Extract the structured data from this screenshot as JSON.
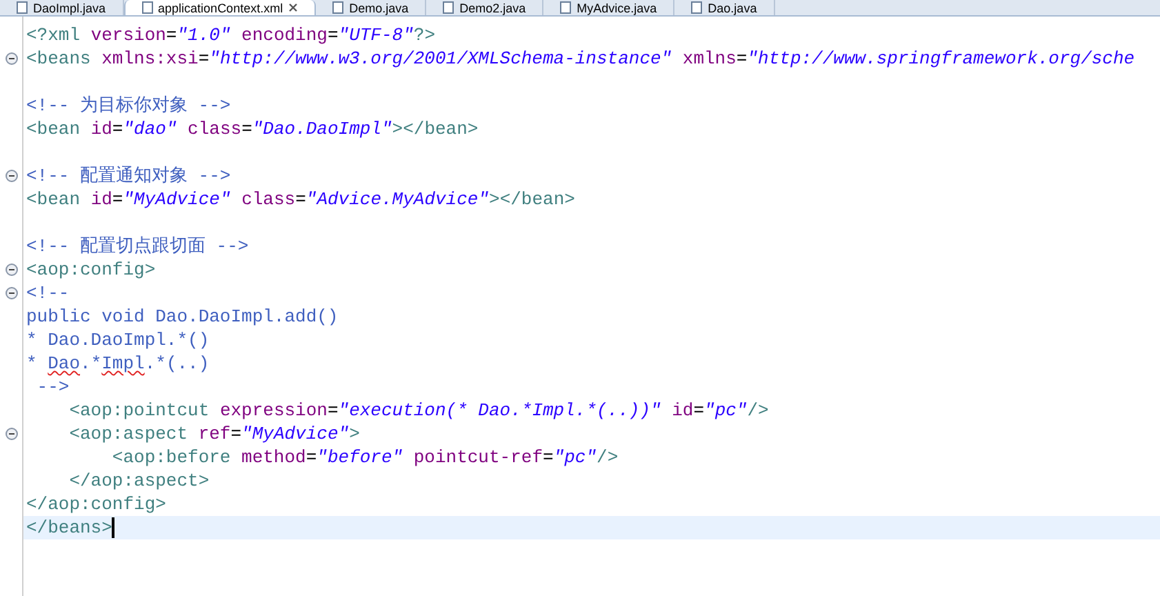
{
  "tabs": [
    {
      "label": "DaoImpl.java",
      "selected": false,
      "closable": false
    },
    {
      "label": "applicationContext.xml",
      "selected": true,
      "closable": true
    },
    {
      "label": "Demo.java",
      "selected": false,
      "closable": false
    },
    {
      "label": "Demo2.java",
      "selected": false,
      "closable": false
    },
    {
      "label": "MyAdvice.java",
      "selected": false,
      "closable": false
    },
    {
      "label": "Dao.java",
      "selected": false,
      "closable": false
    }
  ],
  "editor": {
    "lines": [
      {
        "fold": false,
        "current": false,
        "tokens": [
          {
            "kind": "tag",
            "text": "<?xml "
          },
          {
            "kind": "attr",
            "text": "version"
          },
          {
            "kind": "text",
            "text": "="
          },
          {
            "kind": "value",
            "text": "\"1.0\" "
          },
          {
            "kind": "attr",
            "text": "encoding"
          },
          {
            "kind": "text",
            "text": "="
          },
          {
            "kind": "value",
            "text": "\"UTF-8\""
          },
          {
            "kind": "tag",
            "text": "?>"
          }
        ]
      },
      {
        "fold": true,
        "current": false,
        "tokens": [
          {
            "kind": "tag",
            "text": "<beans "
          },
          {
            "kind": "attr",
            "text": "xmlns:xsi"
          },
          {
            "kind": "text",
            "text": "="
          },
          {
            "kind": "value",
            "text": "\"http://www.w3.org/2001/XMLSchema-instance\" "
          },
          {
            "kind": "attr",
            "text": "xmlns"
          },
          {
            "kind": "text",
            "text": "="
          },
          {
            "kind": "value",
            "text": "\"http://www.springframework.org/sche"
          }
        ]
      },
      {
        "fold": false,
        "current": false
      },
      {
        "fold": false,
        "current": false,
        "tokens": [
          {
            "kind": "comment",
            "text": "<!-- 为目标你对象 -->"
          }
        ]
      },
      {
        "fold": false,
        "current": false,
        "tokens": [
          {
            "kind": "tag",
            "text": "<bean "
          },
          {
            "kind": "attr",
            "text": "id"
          },
          {
            "kind": "text",
            "text": "="
          },
          {
            "kind": "value",
            "text": "\"dao\" "
          },
          {
            "kind": "attr",
            "text": "class"
          },
          {
            "kind": "text",
            "text": "="
          },
          {
            "kind": "value",
            "text": "\"Dao.DaoImpl\""
          },
          {
            "kind": "tag",
            "text": "></bean>"
          }
        ]
      },
      {
        "fold": false,
        "current": false
      },
      {
        "fold": true,
        "current": false,
        "tokens": [
          {
            "kind": "comment",
            "text": "<!-- 配置通知对象 -->"
          }
        ]
      },
      {
        "fold": false,
        "current": false,
        "tokens": [
          {
            "kind": "tag",
            "text": "<bean "
          },
          {
            "kind": "attr",
            "text": "id"
          },
          {
            "kind": "text",
            "text": "="
          },
          {
            "kind": "value",
            "text": "\"MyAdvice\" "
          },
          {
            "kind": "attr",
            "text": "class"
          },
          {
            "kind": "text",
            "text": "="
          },
          {
            "kind": "value",
            "text": "\"Advice.MyAdvice\""
          },
          {
            "kind": "tag",
            "text": "></bean>"
          }
        ]
      },
      {
        "fold": false,
        "current": false
      },
      {
        "fold": false,
        "current": false,
        "tokens": [
          {
            "kind": "comment",
            "text": "<!-- 配置切点跟切面 -->"
          }
        ]
      },
      {
        "fold": true,
        "current": false,
        "tokens": [
          {
            "kind": "tag",
            "text": "<aop:config>"
          }
        ]
      },
      {
        "fold": true,
        "current": false,
        "tokens": [
          {
            "kind": "comment",
            "text": "<!--"
          }
        ]
      },
      {
        "fold": false,
        "current": false,
        "tokens": [
          {
            "kind": "comment",
            "text": "public void Dao.DaoImpl.add()"
          }
        ]
      },
      {
        "fold": false,
        "current": false,
        "tokens": [
          {
            "kind": "comment",
            "text": "* Dao.DaoImpl.*()"
          }
        ]
      },
      {
        "fold": false,
        "current": false,
        "tokens": [
          {
            "kind": "comment",
            "text": "* "
          },
          {
            "kind": "comment",
            "text": "Dao",
            "misspelled": true
          },
          {
            "kind": "comment",
            "text": ".*"
          },
          {
            "kind": "comment",
            "text": "Impl",
            "misspelled": true
          },
          {
            "kind": "comment",
            "text": ".*(..)"
          }
        ]
      },
      {
        "fold": false,
        "current": false,
        "tokens": [
          {
            "kind": "comment",
            "text": " -->"
          }
        ]
      },
      {
        "fold": false,
        "current": false,
        "tokens": [
          {
            "kind": "tag",
            "text": "    <aop:pointcut "
          },
          {
            "kind": "attr",
            "text": "expression"
          },
          {
            "kind": "text",
            "text": "="
          },
          {
            "kind": "value",
            "text": "\"execution(* Dao.*Impl.*(..))\" "
          },
          {
            "kind": "attr",
            "text": "id"
          },
          {
            "kind": "text",
            "text": "="
          },
          {
            "kind": "value",
            "text": "\"pc\""
          },
          {
            "kind": "tag",
            "text": "/>"
          }
        ]
      },
      {
        "fold": true,
        "current": false,
        "tokens": [
          {
            "kind": "tag",
            "text": "    <aop:aspect "
          },
          {
            "kind": "attr",
            "text": "ref"
          },
          {
            "kind": "text",
            "text": "="
          },
          {
            "kind": "value",
            "text": "\"MyAdvice\""
          },
          {
            "kind": "tag",
            "text": ">"
          }
        ]
      },
      {
        "fold": false,
        "current": false,
        "tokens": [
          {
            "kind": "tag",
            "text": "        <aop:before "
          },
          {
            "kind": "attr",
            "text": "method"
          },
          {
            "kind": "text",
            "text": "="
          },
          {
            "kind": "value",
            "text": "\"before\" "
          },
          {
            "kind": "attr",
            "text": "pointcut-ref"
          },
          {
            "kind": "text",
            "text": "="
          },
          {
            "kind": "value",
            "text": "\"pc\""
          },
          {
            "kind": "tag",
            "text": "/>"
          }
        ]
      },
      {
        "fold": false,
        "current": false,
        "tokens": [
          {
            "kind": "tag",
            "text": "    </aop:aspect>"
          }
        ]
      },
      {
        "fold": false,
        "current": false,
        "tokens": [
          {
            "kind": "tag",
            "text": "</aop:config>"
          }
        ]
      },
      {
        "fold": false,
        "current": true,
        "tokens": [
          {
            "kind": "tag",
            "text": "</beans>"
          }
        ]
      }
    ]
  }
}
